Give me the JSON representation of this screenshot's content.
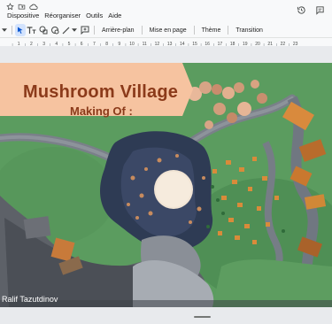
{
  "menu": {
    "items": [
      "Dispositive",
      "Réorganiser",
      "Outils",
      "Aide"
    ]
  },
  "toolbar": {
    "background_label": "Arrière-plan",
    "layout_label": "Mise en page",
    "theme_label": "Thème",
    "transition_label": "Transition"
  },
  "ruler": {
    "ticks": [
      "1",
      "2",
      "3",
      "4",
      "5",
      "6",
      "7",
      "8",
      "9",
      "10",
      "11",
      "12",
      "13",
      "14",
      "15",
      "16",
      "17",
      "18",
      "19",
      "20",
      "21",
      "22",
      "23"
    ]
  },
  "slide": {
    "title": "Mushroom Village",
    "subtitle": "Making Of :",
    "author": "Ralif Tazutdinov"
  },
  "colors": {
    "banner": "#f6c3a0",
    "title_text": "#8b3a1a",
    "grass": "#5a9a5e",
    "accent": "#1a73e8"
  }
}
